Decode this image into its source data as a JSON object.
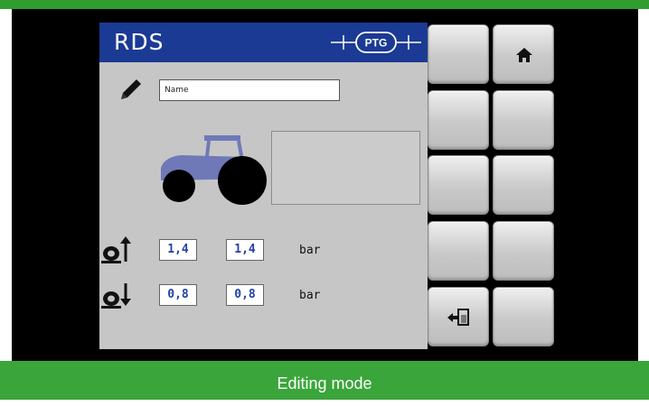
{
  "header": {
    "title": "RDS",
    "logo_text": "PTG"
  },
  "name_field": {
    "value": "Name"
  },
  "pressure": {
    "inflate": {
      "icon": "tyre-pressure-up-icon",
      "value1": "1,4",
      "value2": "1,4",
      "unit": "bar"
    },
    "deflate": {
      "icon": "tyre-pressure-down-icon",
      "value1": "0,8",
      "value2": "0,8",
      "unit": "bar"
    }
  },
  "softkeys": [
    {
      "icon": ""
    },
    {
      "icon": "home-icon"
    },
    {
      "icon": ""
    },
    {
      "icon": ""
    },
    {
      "icon": ""
    },
    {
      "icon": ""
    },
    {
      "icon": ""
    },
    {
      "icon": ""
    },
    {
      "icon": "exit-edit-icon"
    },
    {
      "icon": ""
    }
  ],
  "caption": "Editing mode",
  "colors": {
    "header": "#1b3a93",
    "caption_bg": "#3aa53a",
    "value_text": "#2442a8",
    "panel": "#c6c6c6"
  }
}
